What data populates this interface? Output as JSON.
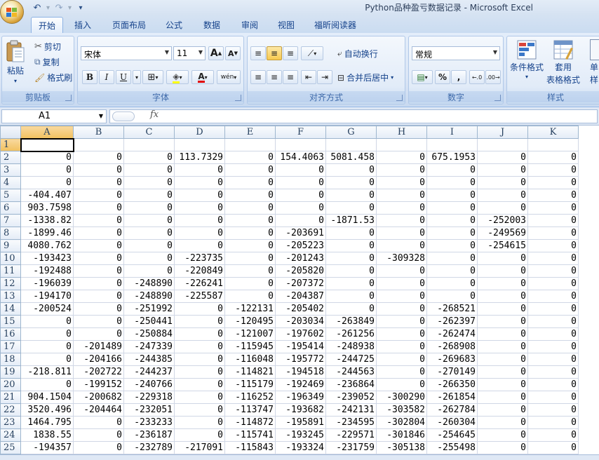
{
  "app": {
    "title": "Python品种盈亏数据记录 - Microsoft Excel"
  },
  "tabs": [
    "开始",
    "插入",
    "页面布局",
    "公式",
    "数据",
    "审阅",
    "视图",
    "福昕阅读器"
  ],
  "ribbon": {
    "clipboard": {
      "label": "剪贴板",
      "paste": "粘贴",
      "cut": "剪切",
      "copy": "复制",
      "format_painter": "格式刷"
    },
    "font": {
      "label": "字体",
      "font_name": "宋体",
      "font_size": "11",
      "bold": "B",
      "italic": "I",
      "underline": "U",
      "grow": "A",
      "shrink": "A",
      "color_a": "A",
      "phonetic": "wén"
    },
    "alignment": {
      "label": "对齐方式",
      "wrap": "自动换行",
      "merge": "合并后居中"
    },
    "number": {
      "label": "数字",
      "format": "常规",
      "percent": "%",
      "comma": ","
    },
    "styles": {
      "label": "样式",
      "conditional": "条件格式",
      "table_line1": "套用",
      "table_line2": "表格格式",
      "cell_partial": "单",
      "cell_partial2": "样"
    }
  },
  "formula_bar": {
    "name_box": "A1",
    "fx": "fx",
    "value": ""
  },
  "sheet": {
    "columns": [
      "A",
      "B",
      "C",
      "D",
      "E",
      "F",
      "G",
      "H",
      "I",
      "J",
      "K"
    ],
    "rows": [
      {
        "n": "1",
        "cells": [
          "",
          "",
          "",
          "",
          "",
          "",
          "",
          "",
          "",
          "",
          ""
        ]
      },
      {
        "n": "2",
        "cells": [
          "0",
          "0",
          "0",
          "113.7329",
          "0",
          "154.4063",
          "5081.458",
          "0",
          "675.1953",
          "0",
          "0"
        ]
      },
      {
        "n": "3",
        "cells": [
          "0",
          "0",
          "0",
          "0",
          "0",
          "0",
          "0",
          "0",
          "0",
          "0",
          "0"
        ]
      },
      {
        "n": "4",
        "cells": [
          "0",
          "0",
          "0",
          "0",
          "0",
          "0",
          "0",
          "0",
          "0",
          "0",
          "0"
        ]
      },
      {
        "n": "5",
        "cells": [
          "-404.407",
          "0",
          "0",
          "0",
          "0",
          "0",
          "0",
          "0",
          "0",
          "0",
          "0"
        ]
      },
      {
        "n": "6",
        "cells": [
          "903.7598",
          "0",
          "0",
          "0",
          "0",
          "0",
          "0",
          "0",
          "0",
          "0",
          "0"
        ]
      },
      {
        "n": "7",
        "cells": [
          "-1338.82",
          "0",
          "0",
          "0",
          "0",
          "0",
          "-1871.53",
          "0",
          "0",
          "-252003",
          "0"
        ]
      },
      {
        "n": "8",
        "cells": [
          "-1899.46",
          "0",
          "0",
          "0",
          "0",
          "-203691",
          "0",
          "0",
          "0",
          "-249569",
          "0"
        ]
      },
      {
        "n": "9",
        "cells": [
          "4080.762",
          "0",
          "0",
          "0",
          "0",
          "-205223",
          "0",
          "0",
          "0",
          "-254615",
          "0"
        ]
      },
      {
        "n": "10",
        "cells": [
          "-193423",
          "0",
          "0",
          "-223735",
          "0",
          "-201243",
          "0",
          "-309328",
          "0",
          "0",
          "0"
        ]
      },
      {
        "n": "11",
        "cells": [
          "-192488",
          "0",
          "0",
          "-220849",
          "0",
          "-205820",
          "0",
          "0",
          "0",
          "0",
          "0"
        ]
      },
      {
        "n": "12",
        "cells": [
          "-196039",
          "0",
          "-248890",
          "-226241",
          "0",
          "-207372",
          "0",
          "0",
          "0",
          "0",
          "0"
        ]
      },
      {
        "n": "13",
        "cells": [
          "-194170",
          "0",
          "-248890",
          "-225587",
          "0",
          "-204387",
          "0",
          "0",
          "0",
          "0",
          "0"
        ]
      },
      {
        "n": "14",
        "cells": [
          "-200524",
          "0",
          "-251992",
          "0",
          "-122131",
          "-205402",
          "0",
          "0",
          "-268521",
          "0",
          "0"
        ]
      },
      {
        "n": "15",
        "cells": [
          "0",
          "0",
          "-250441",
          "0",
          "-120495",
          "-203034",
          "-263849",
          "0",
          "-262397",
          "0",
          "0"
        ]
      },
      {
        "n": "16",
        "cells": [
          "0",
          "0",
          "-250884",
          "0",
          "-121007",
          "-197602",
          "-261256",
          "0",
          "-262474",
          "0",
          "0"
        ]
      },
      {
        "n": "17",
        "cells": [
          "0",
          "-201489",
          "-247339",
          "0",
          "-115945",
          "-195414",
          "-248938",
          "0",
          "-268908",
          "0",
          "0"
        ]
      },
      {
        "n": "18",
        "cells": [
          "0",
          "-204166",
          "-244385",
          "0",
          "-116048",
          "-195772",
          "-244725",
          "0",
          "-269683",
          "0",
          "0"
        ]
      },
      {
        "n": "19",
        "cells": [
          "-218.811",
          "-202722",
          "-244237",
          "0",
          "-114821",
          "-194518",
          "-244563",
          "0",
          "-270149",
          "0",
          "0"
        ]
      },
      {
        "n": "20",
        "cells": [
          "0",
          "-199152",
          "-240766",
          "0",
          "-115179",
          "-192469",
          "-236864",
          "0",
          "-266350",
          "0",
          "0"
        ]
      },
      {
        "n": "21",
        "cells": [
          "904.1504",
          "-200682",
          "-229318",
          "0",
          "-116252",
          "-196349",
          "-239052",
          "-300290",
          "-261854",
          "0",
          "0"
        ]
      },
      {
        "n": "22",
        "cells": [
          "3520.496",
          "-204464",
          "-232051",
          "0",
          "-113747",
          "-193682",
          "-242131",
          "-303582",
          "-262784",
          "0",
          "0"
        ]
      },
      {
        "n": "23",
        "cells": [
          "1464.795",
          "0",
          "-233233",
          "0",
          "-114872",
          "-195891",
          "-234595",
          "-302804",
          "-260304",
          "0",
          "0"
        ]
      },
      {
        "n": "24",
        "cells": [
          "1838.55",
          "0",
          "-236187",
          "0",
          "-115741",
          "-193245",
          "-229571",
          "-301846",
          "-254645",
          "0",
          "0"
        ]
      },
      {
        "n": "25",
        "cells": [
          "-194357",
          "0",
          "-232789",
          "-217091",
          "-115843",
          "-193324",
          "-231759",
          "-305138",
          "-255498",
          "0",
          "0"
        ]
      }
    ]
  }
}
